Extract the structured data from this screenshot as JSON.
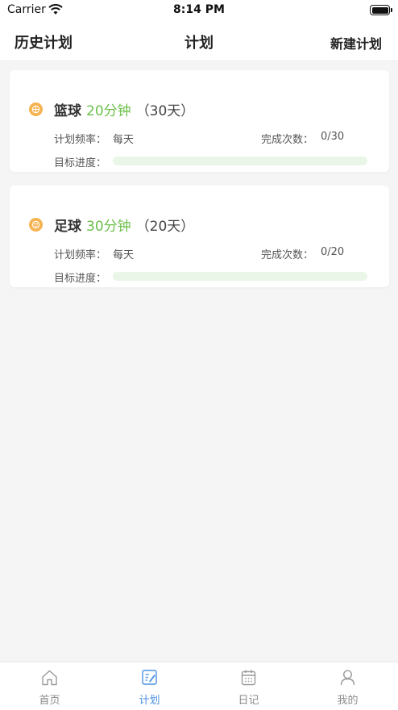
{
  "status_bar": {
    "carrier": "Carrier",
    "time": "8:14 PM"
  },
  "nav": {
    "left": "历史计划",
    "title": "计划",
    "right": "新建计划"
  },
  "labels": {
    "frequency": "计划频率：",
    "count": "完成次数：",
    "progress": "目标进度："
  },
  "plans": [
    {
      "icon": "basketball-icon",
      "name": "篮球",
      "duration": "20分钟",
      "days": "（30天）",
      "frequency": "每天",
      "count": "0/30",
      "progress": 0
    },
    {
      "icon": "soccer-icon",
      "name": "足球",
      "duration": "30分钟",
      "days": "（20天）",
      "frequency": "每天",
      "count": "0/20",
      "progress": 0
    }
  ],
  "tabs": [
    {
      "icon": "home-icon",
      "label": "首页",
      "active": false
    },
    {
      "icon": "plan-icon",
      "label": "计划",
      "active": true
    },
    {
      "icon": "calendar-icon",
      "label": "日记",
      "active": false
    },
    {
      "icon": "user-icon",
      "label": "我的",
      "active": false
    }
  ],
  "colors": {
    "accent_green": "#6cc04a",
    "active_tab": "#4a90e2",
    "ball_orange": "#f5b352"
  }
}
